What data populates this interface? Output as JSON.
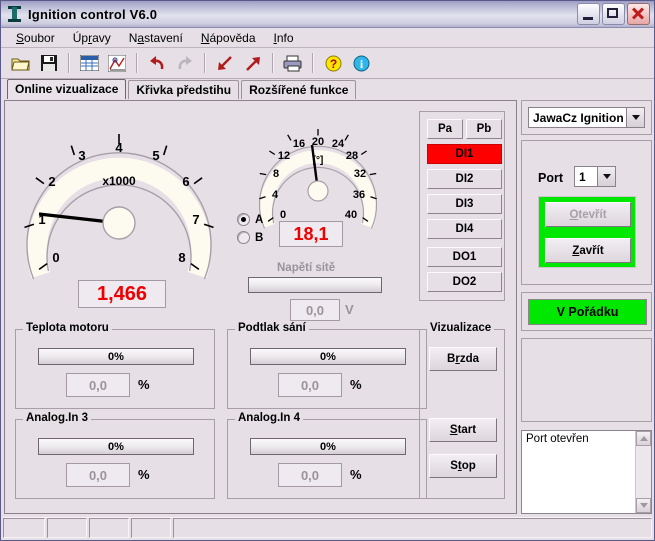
{
  "window": {
    "title": "Ignition control V6.0",
    "icon": "ignition-icon",
    "minimize": "minimize-icon",
    "maximize": "maximize-icon",
    "close": "close-icon"
  },
  "menu": {
    "items": [
      {
        "label": "Soubor",
        "accel": "S"
      },
      {
        "label": "Úpravy",
        "accel": "r"
      },
      {
        "label": "Nastavení",
        "accel": "a"
      },
      {
        "label": "Nápověda",
        "accel": "N"
      },
      {
        "label": "Info",
        "accel": "I"
      }
    ]
  },
  "toolbar": {
    "buttons": [
      {
        "name": "open-icon",
        "enabled": true
      },
      {
        "name": "save-icon",
        "enabled": true
      },
      {
        "name": "table-icon",
        "enabled": true
      },
      {
        "name": "chart-icon",
        "enabled": true
      },
      {
        "name": "undo-icon",
        "enabled": true
      },
      {
        "name": "redo-icon",
        "enabled": false
      },
      {
        "name": "download-arrow-icon",
        "enabled": true
      },
      {
        "name": "upload-arrow-icon",
        "enabled": true
      },
      {
        "name": "print-icon",
        "enabled": true
      },
      {
        "name": "help-icon",
        "enabled": true
      },
      {
        "name": "info-icon",
        "enabled": true
      }
    ]
  },
  "tabs": [
    {
      "label": "Online vizualizace",
      "active": true
    },
    {
      "label": "Křivka předstihu",
      "active": false
    },
    {
      "label": "Rozšířené funkce",
      "active": false
    }
  ],
  "gauges": {
    "rpm": {
      "unit_label": "x1000",
      "ticks": [
        "0",
        "1",
        "2",
        "3",
        "4",
        "5",
        "6",
        "7",
        "8"
      ],
      "min": 0,
      "max": 8,
      "value": 1.466,
      "value_text": "1,466"
    },
    "advance": {
      "unit_label": "[°]",
      "ticks": [
        "0",
        "4",
        "8",
        "12",
        "16",
        "20",
        "24",
        "28",
        "32",
        "36",
        "40"
      ],
      "min": 0,
      "max": 40,
      "value": 18.1,
      "value_text": "18,1"
    }
  },
  "curve_select": {
    "options": [
      {
        "label": "A",
        "selected": true
      },
      {
        "label": "B",
        "selected": false
      }
    ]
  },
  "mains": {
    "label": "Napětí sítě",
    "bar_percent": 0,
    "value": "0,0",
    "unit": "V"
  },
  "analog_groups": [
    {
      "title": "Teplota motoru",
      "bar_label": "0%",
      "bar_percent": 0,
      "value": "0,0",
      "unit": "%"
    },
    {
      "title": "Podtlak sání",
      "bar_label": "0%",
      "bar_percent": 0,
      "value": "0,0",
      "unit": "%"
    },
    {
      "title": "Analog.In 3",
      "bar_label": "0%",
      "bar_percent": 0,
      "value": "0,0",
      "unit": "%"
    },
    {
      "title": "Analog.In 4",
      "bar_label": "0%",
      "bar_percent": 0,
      "value": "0,0",
      "unit": "%"
    }
  ],
  "io_status": {
    "pa": {
      "label": "Pa",
      "active": false
    },
    "pb": {
      "label": "Pb",
      "active": false
    },
    "items": [
      {
        "label": "DI1",
        "active": true
      },
      {
        "label": "DI2",
        "active": false
      },
      {
        "label": "DI3",
        "active": false
      },
      {
        "label": "DI4",
        "active": false
      },
      {
        "label": "DO1",
        "active": false
      },
      {
        "label": "DO2",
        "active": false
      }
    ],
    "active_color": "#ff0000"
  },
  "visualization": {
    "title": "Vizualizace",
    "brake": {
      "label": "Brzda",
      "accel": "r"
    },
    "start": {
      "label": "Start",
      "accel": "S"
    },
    "stop": {
      "label": "Stop",
      "accel": "t"
    }
  },
  "device": {
    "selected": "JawaCz Ignition"
  },
  "port": {
    "label": "Port",
    "selected": "1",
    "open_button": {
      "label": "Otevřít",
      "accel": "O",
      "enabled": false
    },
    "close_button": {
      "label": "Zavřít",
      "accel": "Z",
      "enabled": true
    },
    "highlight_color": "#00e800"
  },
  "status": {
    "text": "V Pořádku",
    "color": "#00e800"
  },
  "log": {
    "lines": [
      "Port otevřen"
    ]
  },
  "statusbar": {
    "panels": [
      "",
      "",
      "",
      "",
      ""
    ]
  }
}
